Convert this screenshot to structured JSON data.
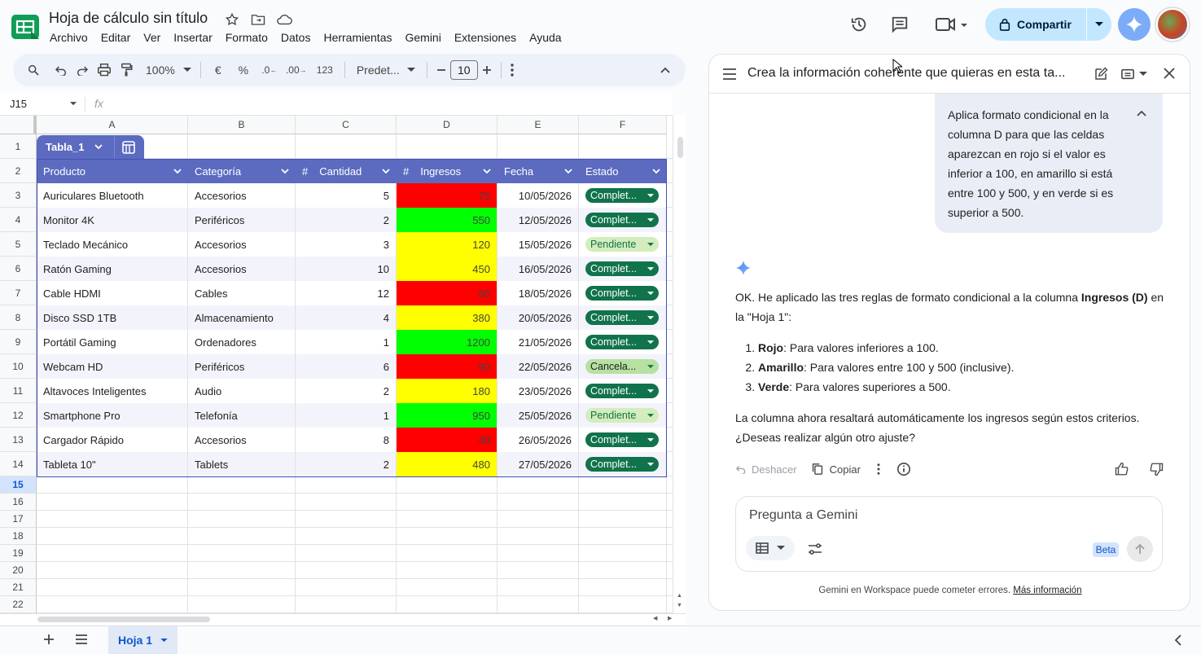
{
  "doc": {
    "title": "Hoja de cálculo sin título"
  },
  "menu": [
    "Archivo",
    "Editar",
    "Ver",
    "Insertar",
    "Formato",
    "Datos",
    "Herramientas",
    "Gemini",
    "Extensiones",
    "Ayuda"
  ],
  "share": {
    "label": "Compartir"
  },
  "toolbar": {
    "zoom": "100%",
    "currency": "€",
    "percent": "%",
    "dec_less": ".0",
    "dec_more": ".00",
    "format123": "123",
    "font": "Predet...",
    "font_size": "10"
  },
  "formula_bar": {
    "cell_ref": "J15",
    "fx": "fx"
  },
  "columns": [
    "A",
    "B",
    "C",
    "D",
    "E",
    "F"
  ],
  "rows": [
    "1",
    "2",
    "3",
    "4",
    "5",
    "6",
    "7",
    "8",
    "9",
    "10",
    "11",
    "12",
    "13",
    "14",
    "15",
    "16",
    "17",
    "18",
    "19",
    "20",
    "21",
    "22"
  ],
  "selected_row": "15",
  "table": {
    "name": "Tabla_1",
    "headers": [
      "Producto",
      "Categoría",
      "Cantidad",
      "Ingresos",
      "Fecha",
      "Estado"
    ],
    "header_hash": "#",
    "rows": [
      {
        "producto": "Auriculares Bluetooth",
        "categoria": "Accesorios",
        "cantidad": "5",
        "ingresos": "75",
        "fecha": "10/05/2026",
        "estado": "Complet...",
        "ing_color": "#ff0000",
        "est_style": "dark"
      },
      {
        "producto": "Monitor 4K",
        "categoria": "Periféricos",
        "cantidad": "2",
        "ingresos": "550",
        "fecha": "12/05/2026",
        "estado": "Complet...",
        "ing_color": "#00ff00",
        "est_style": "dark"
      },
      {
        "producto": "Teclado Mecánico",
        "categoria": "Accesorios",
        "cantidad": "3",
        "ingresos": "120",
        "fecha": "15/05/2026",
        "estado": "Pendiente",
        "ing_color": "#ffff00",
        "est_style": "light"
      },
      {
        "producto": "Ratón Gaming",
        "categoria": "Accesorios",
        "cantidad": "10",
        "ingresos": "450",
        "fecha": "16/05/2026",
        "estado": "Complet...",
        "ing_color": "#ffff00",
        "est_style": "dark"
      },
      {
        "producto": "Cable HDMI",
        "categoria": "Cables",
        "cantidad": "12",
        "ingresos": "60",
        "fecha": "18/05/2026",
        "estado": "Complet...",
        "ing_color": "#ff0000",
        "est_style": "dark"
      },
      {
        "producto": "Disco SSD 1TB",
        "categoria": "Almacenamiento",
        "cantidad": "4",
        "ingresos": "380",
        "fecha": "20/05/2026",
        "estado": "Complet...",
        "ing_color": "#ffff00",
        "est_style": "dark"
      },
      {
        "producto": "Portátil Gaming",
        "categoria": "Ordenadores",
        "cantidad": "1",
        "ingresos": "1200",
        "fecha": "21/05/2026",
        "estado": "Complet...",
        "ing_color": "#00ff00",
        "est_style": "dark"
      },
      {
        "producto": "Webcam HD",
        "categoria": "Periféricos",
        "cantidad": "6",
        "ingresos": "90",
        "fecha": "22/05/2026",
        "estado": "Cancela...",
        "ing_color": "#ff0000",
        "est_style": "mid"
      },
      {
        "producto": "Altavoces Inteligentes",
        "categoria": "Audio",
        "cantidad": "2",
        "ingresos": "180",
        "fecha": "23/05/2026",
        "estado": "Complet...",
        "ing_color": "#ffff00",
        "est_style": "dark"
      },
      {
        "producto": "Smartphone Pro",
        "categoria": "Telefonía",
        "cantidad": "1",
        "ingresos": "950",
        "fecha": "25/05/2026",
        "estado": "Pendiente",
        "ing_color": "#00ff00",
        "est_style": "light"
      },
      {
        "producto": "Cargador Rápido",
        "categoria": "Accesorios",
        "cantidad": "8",
        "ingresos": "40",
        "fecha": "26/05/2026",
        "estado": "Complet...",
        "ing_color": "#ff0000",
        "est_style": "dark"
      },
      {
        "producto": "Tableta 10\"",
        "categoria": "Tablets",
        "cantidad": "2",
        "ingresos": "480",
        "fecha": "27/05/2026",
        "estado": "Complet...",
        "ing_color": "#ffff00",
        "est_style": "dark"
      }
    ]
  },
  "sheet_tab": {
    "label": "Hoja 1"
  },
  "gemini": {
    "title": "Crea la información coherente que quieras en esta ta...",
    "user_message": "Aplica formato condicional en la columna D para que las celdas aparezcan en rojo si el valor es inferior a 100, en amarillo si está entre 100 y 500, y en verde si es superior a 500.",
    "response_intro_a": "OK. He aplicado las tres reglas de formato condicional a la columna ",
    "response_intro_bold": "Ingresos (D)",
    "response_intro_b": " en la \"Hoja 1\":",
    "rules": [
      {
        "bold": "Rojo",
        "text": ": Para valores inferiores a 100."
      },
      {
        "bold": "Amarillo",
        "text": ": Para valores entre 100 y 500 (inclusive)."
      },
      {
        "bold": "Verde",
        "text": ": Para valores superiores a 500."
      }
    ],
    "response_outro": "La columna ahora resaltará automáticamente los ingresos según estos criterios. ¿Deseas realizar algún otro ajuste?",
    "undo_label": "Deshacer",
    "copy_label": "Copiar",
    "input_placeholder": "Pregunta a Gemini",
    "beta": "Beta",
    "footer_text": "Gemini en Workspace puede cometer errores. ",
    "footer_link": "Más información"
  },
  "colors": {
    "table_header": "#5c6bc0",
    "share_bg": "#c2e7ff",
    "accent": "#0b57d0",
    "chip_dark": "#11734b"
  }
}
